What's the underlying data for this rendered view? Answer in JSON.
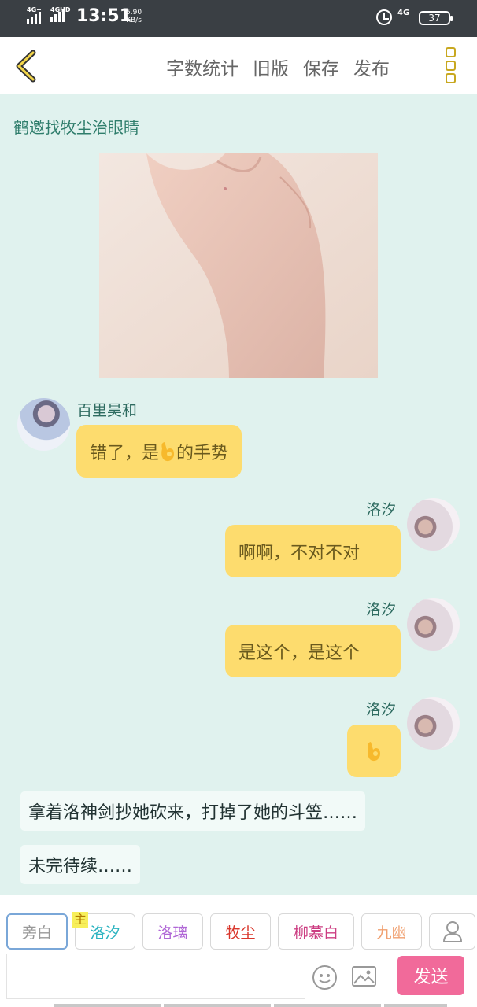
{
  "status_bar": {
    "sim1": "4G+",
    "sim2": "4GHD",
    "time": "13:51",
    "speed_value": "5.90",
    "speed_unit": "KB/s",
    "network_right": "4G",
    "battery": "37"
  },
  "header": {
    "actions": [
      "字数统计",
      "旧版",
      "保存",
      "发布"
    ]
  },
  "chat": {
    "title": "鹤邀找牧尘治眼睛",
    "messages": [
      {
        "side": "left",
        "sender": "百里昊和",
        "text_before": "错了，是",
        "text_after": "的手势"
      },
      {
        "side": "right",
        "sender": "洛汐",
        "text": "啊啊，不对不对"
      },
      {
        "side": "right",
        "sender": "洛汐",
        "text": "是这个，是这个"
      },
      {
        "side": "right",
        "sender": "洛汐",
        "emoji": "ok-hand"
      }
    ],
    "narration": [
      "拿着洛神剑抄她砍来，打掉了她的斗笠……",
      "未完待续……"
    ]
  },
  "toolbar": {
    "roles": [
      {
        "label": "旁白",
        "color": "#999999"
      },
      {
        "label": "洛汐",
        "color": "#2bb3c0",
        "badge": "主"
      },
      {
        "label": "洛璃",
        "color": "#b067d6"
      },
      {
        "label": "牧尘",
        "color": "#d9362b"
      },
      {
        "label": "柳慕白",
        "color": "#cc3d82"
      },
      {
        "label": "九幽",
        "color": "#f0a070"
      }
    ],
    "input_placeholder": "",
    "send_label": "发送"
  },
  "colors": {
    "background": "#e0f2ee",
    "bubble": "#fddc6e",
    "send": "#f16a9a",
    "accent_icon": "#c8a820"
  },
  "icons": [
    "back-chevron-icon",
    "more-menu-icon",
    "emoji-icon",
    "image-icon",
    "user-icon",
    "alarm-icon",
    "battery-icon",
    "signal-icon"
  ]
}
